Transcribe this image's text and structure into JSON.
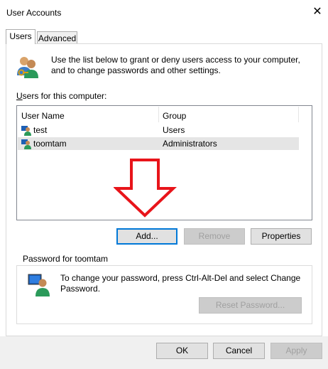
{
  "window": {
    "title": "User Accounts",
    "close_glyph": "✕"
  },
  "tabs": [
    {
      "label": "Users"
    },
    {
      "label": "Advanced"
    }
  ],
  "intro": {
    "icon": "users-keys-icon",
    "text": "Use the list below to grant or deny users access to your computer, and to change passwords and other settings."
  },
  "users_list": {
    "label": "Users for this computer:",
    "columns": [
      "User Name",
      "Group"
    ],
    "rows": [
      {
        "name": "test",
        "group": "Users",
        "icon": "user-icon",
        "selected": false
      },
      {
        "name": "toomtam",
        "group": "Administrators",
        "icon": "user-icon",
        "selected": true
      }
    ]
  },
  "annotation": {
    "icon": "red-down-arrow",
    "color": "#e8141a"
  },
  "list_buttons": {
    "add": "Add...",
    "remove": "Remove",
    "properties": "Properties"
  },
  "password": {
    "legend": "Password for toomtam",
    "icon": "user-monitor-icon",
    "text": "To change your password, press Ctrl-Alt-Del and select Change Password.",
    "reset_label": "Reset Password..."
  },
  "footer": {
    "ok": "OK",
    "cancel": "Cancel",
    "apply": "Apply"
  },
  "colors": {
    "accent": "#0078d7",
    "selection": "#e5e5e5",
    "disabled_text": "#a0a0a0"
  }
}
